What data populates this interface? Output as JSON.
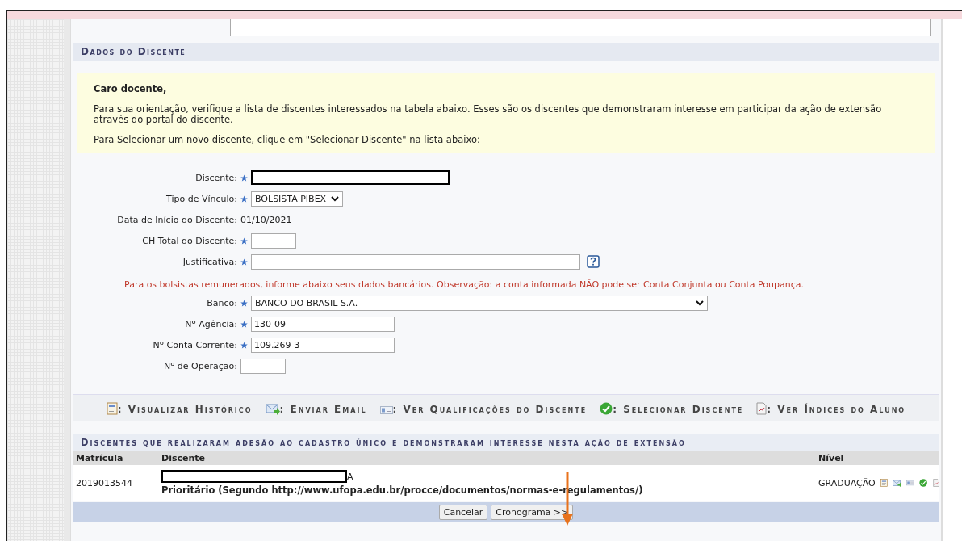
{
  "section_title": "Dados do Discente",
  "notice_box": {
    "greeting": "Caro docente,",
    "paragraphs": [
      "Para sua orientação, verifique a lista de discentes interessados na tabela abaixo. Esses são os discentes que demonstraram interesse em participar da ação de extensão através do portal do discente.",
      "Para Selecionar um novo discente, clique em \"Selecionar Discente\" na lista abaixo:"
    ]
  },
  "form": [
    {
      "kind": "redacted",
      "label": "Discente:",
      "required": true
    },
    {
      "kind": "select",
      "label": "Tipo de Vínculo:",
      "required": true,
      "value": "BOLSISTA PIBEX"
    },
    {
      "kind": "static",
      "label": "Data de Início do Discente:",
      "required": false,
      "value": "01/10/2021"
    },
    {
      "kind": "short_input",
      "label": "CH Total do Discente:",
      "required": true
    },
    {
      "kind": "help_input",
      "label": "Justificativa:",
      "required": true
    },
    {
      "kind": "warning",
      "text": "Para os bolsistas remunerados, informe abaixo seus dados bancários. Observação: a conta informada NÃO pode ser Conta Conjunta ou Conta Poupança."
    },
    {
      "kind": "wide_select",
      "label": "Banco:",
      "required": true,
      "value": "BANCO DO BRASIL S.A."
    },
    {
      "kind": "input",
      "label": "Nº Agência:",
      "required": true,
      "value": "130-09"
    },
    {
      "kind": "input",
      "label": "Nº Conta Corrente:",
      "required": true,
      "value": "109.269-3"
    },
    {
      "kind": "short_input",
      "label": "Nº de Operação:",
      "required": false
    }
  ],
  "legend": [
    ": Visualizar Histórico",
    ": Enviar Email",
    ": Ver Qualificações do Discente",
    ": Selecionar Discente",
    ": Ver Índices do Aluno"
  ],
  "table": {
    "title": "Discentes que realizaram adesão ao cadastro único e demonstraram interesse nesta ação de extensão",
    "columns": [
      "Matrícula",
      "Discente",
      "Nível"
    ],
    "rows": [
      {
        "matricula": "2019013544",
        "name_tail": "A",
        "priority": "Prioritário (Segundo http://www.ufopa.edu.br/procce/documentos/normas-e-regulamentos/)",
        "nivel": "GRADUAÇÃO"
      }
    ]
  },
  "buttons": [
    "Cancelar",
    "Cronograma >>"
  ]
}
